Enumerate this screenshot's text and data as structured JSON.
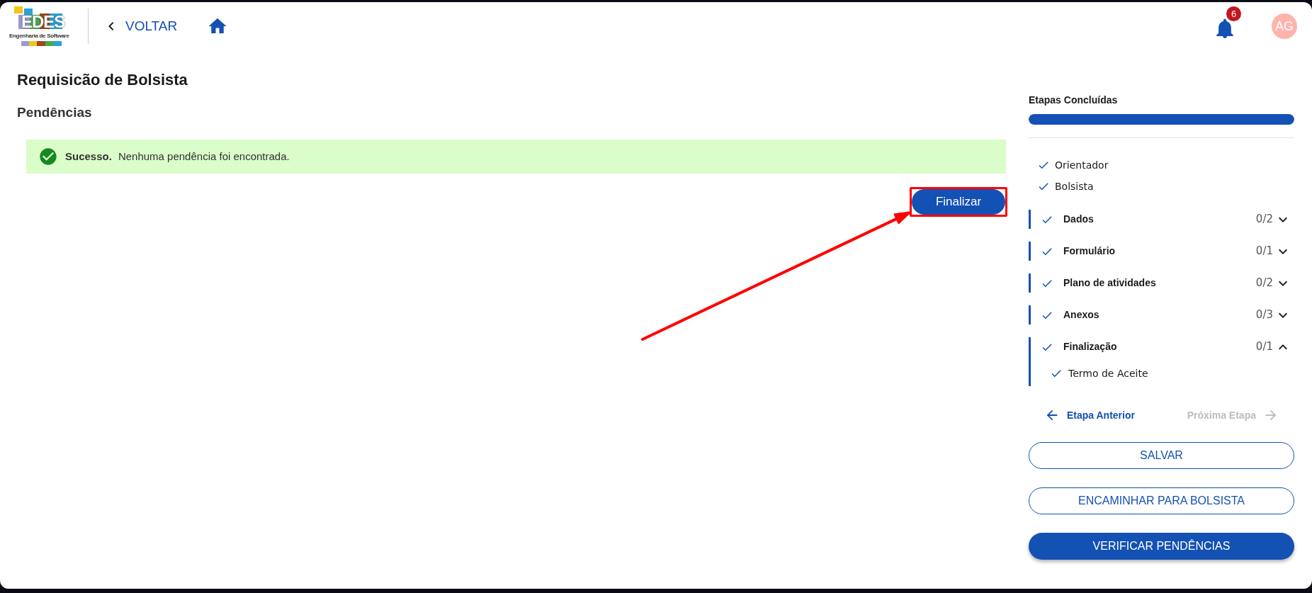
{
  "header": {
    "logo": {
      "wordmark": "EDES",
      "tagline": "Engenharia de Software"
    },
    "back_link": "VOLTAR",
    "notifications": {
      "count": "6"
    },
    "avatar": {
      "initials": "AG"
    }
  },
  "page": {
    "title": "Requisicão de Bolsista",
    "section": "Pendências"
  },
  "alert": {
    "kind": "success",
    "title": "Sucesso.",
    "message": "Nenhuma pendência foi encontrada."
  },
  "primary_action": {
    "label": "Finalizar",
    "highlighted": true
  },
  "sidebar": {
    "progress": {
      "title": "Etapas Concluídas",
      "level": 1
    },
    "steps": [
      {
        "kind": "item",
        "label": "Orientador",
        "done": true
      },
      {
        "kind": "item",
        "label": "Bolsista",
        "done": true
      },
      {
        "kind": "group",
        "label": "Dados",
        "done": true,
        "count": "0/2",
        "expanded": false
      },
      {
        "kind": "group",
        "label": "Formulário",
        "done": true,
        "count": "0/1",
        "expanded": false
      },
      {
        "kind": "group",
        "label": "Plano de atividades",
        "done": true,
        "count": "0/2",
        "expanded": false
      },
      {
        "kind": "group",
        "label": "Anexos",
        "done": true,
        "count": "0/3",
        "expanded": false
      },
      {
        "kind": "group",
        "label": "Finalização",
        "done": true,
        "count": "0/1",
        "expanded": true,
        "children": [
          {
            "label": "Termo de Aceite",
            "done": true
          }
        ]
      }
    ],
    "nav": {
      "previous": {
        "label": "Etapa Anterior",
        "disabled": false
      },
      "next": {
        "label": "Próxima Etapa",
        "disabled": true
      }
    },
    "buttons": [
      {
        "kind": "outline",
        "label": "SALVAR"
      },
      {
        "kind": "outline",
        "label": "ENCAMINHAR PARA BOLSISTA"
      },
      {
        "kind": "filled",
        "label": "VERIFICAR PENDÊNCIAS"
      }
    ]
  }
}
